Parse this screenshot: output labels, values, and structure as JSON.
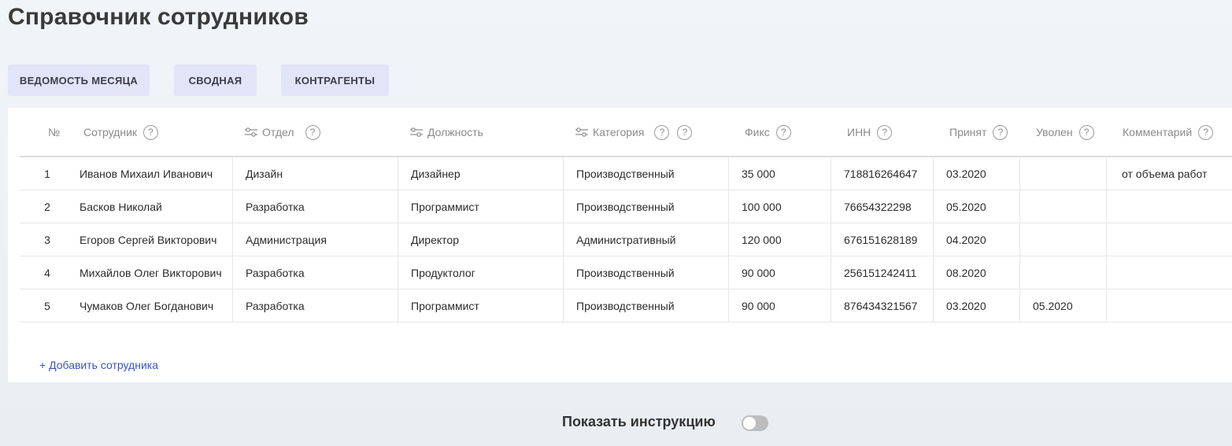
{
  "page": {
    "title": "Справочник сотрудников"
  },
  "tabs": [
    {
      "label": "ВЕДОМОСТЬ МЕСЯЦА"
    },
    {
      "label": "СВОДНАЯ"
    },
    {
      "label": "КОНТРАГЕНТЫ"
    }
  ],
  "table": {
    "columns": {
      "num": "№",
      "employee": "Сотрудник",
      "department": "Отдел",
      "position": "Должность",
      "category": "Категория",
      "fix": "Фикс",
      "inn": "ИНН",
      "hired": "Принят",
      "fired": "Уволен",
      "comment": "Комментарий"
    },
    "help_glyph": "?",
    "rows": [
      {
        "num": "1",
        "employee": "Иванов Михаил Иванович",
        "department": "Дизайн",
        "position": "Дизайнер",
        "category": "Производственный",
        "fix": "35 000",
        "inn": "718816264647",
        "hired": "03.2020",
        "fired": "",
        "comment": "от объема работ"
      },
      {
        "num": "2",
        "employee": "Басков Николай",
        "department": "Разработка",
        "position": "Программист",
        "category": "Производственный",
        "fix": "100 000",
        "inn": "76654322298",
        "hired": "05.2020",
        "fired": "",
        "comment": ""
      },
      {
        "num": "3",
        "employee": "Егоров Сергей Викторович",
        "department": "Администрация",
        "position": "Директор",
        "category": "Административный",
        "fix": "120 000",
        "inn": "676151628189",
        "hired": "04.2020",
        "fired": "",
        "comment": ""
      },
      {
        "num": "4",
        "employee": "Михайлов Олег Викторович",
        "department": "Разработка",
        "position": "Продуктолог",
        "category": "Производственный",
        "fix": "90 000",
        "inn": "256151242411",
        "hired": "08.2020",
        "fired": "",
        "comment": ""
      },
      {
        "num": "5",
        "employee": "Чумаков Олег Богданович",
        "department": "Разработка",
        "position": "Программист",
        "category": "Производственный",
        "fix": "90 000",
        "inn": "876434321567",
        "hired": "03.2020",
        "fired": "05.2020",
        "comment": ""
      }
    ],
    "add_label": "+ Добавить сотрудника"
  },
  "footer": {
    "instruction_label": "Показать инструкцию",
    "instruction_toggle_on": false
  },
  "colors": {
    "accent": "#3a52c9",
    "tab_bg": "#e2e4f8",
    "toggle_off": "#bdbdbd"
  },
  "icons": {
    "filter": "filter-sliders-icon",
    "help": "help-circle-icon"
  }
}
